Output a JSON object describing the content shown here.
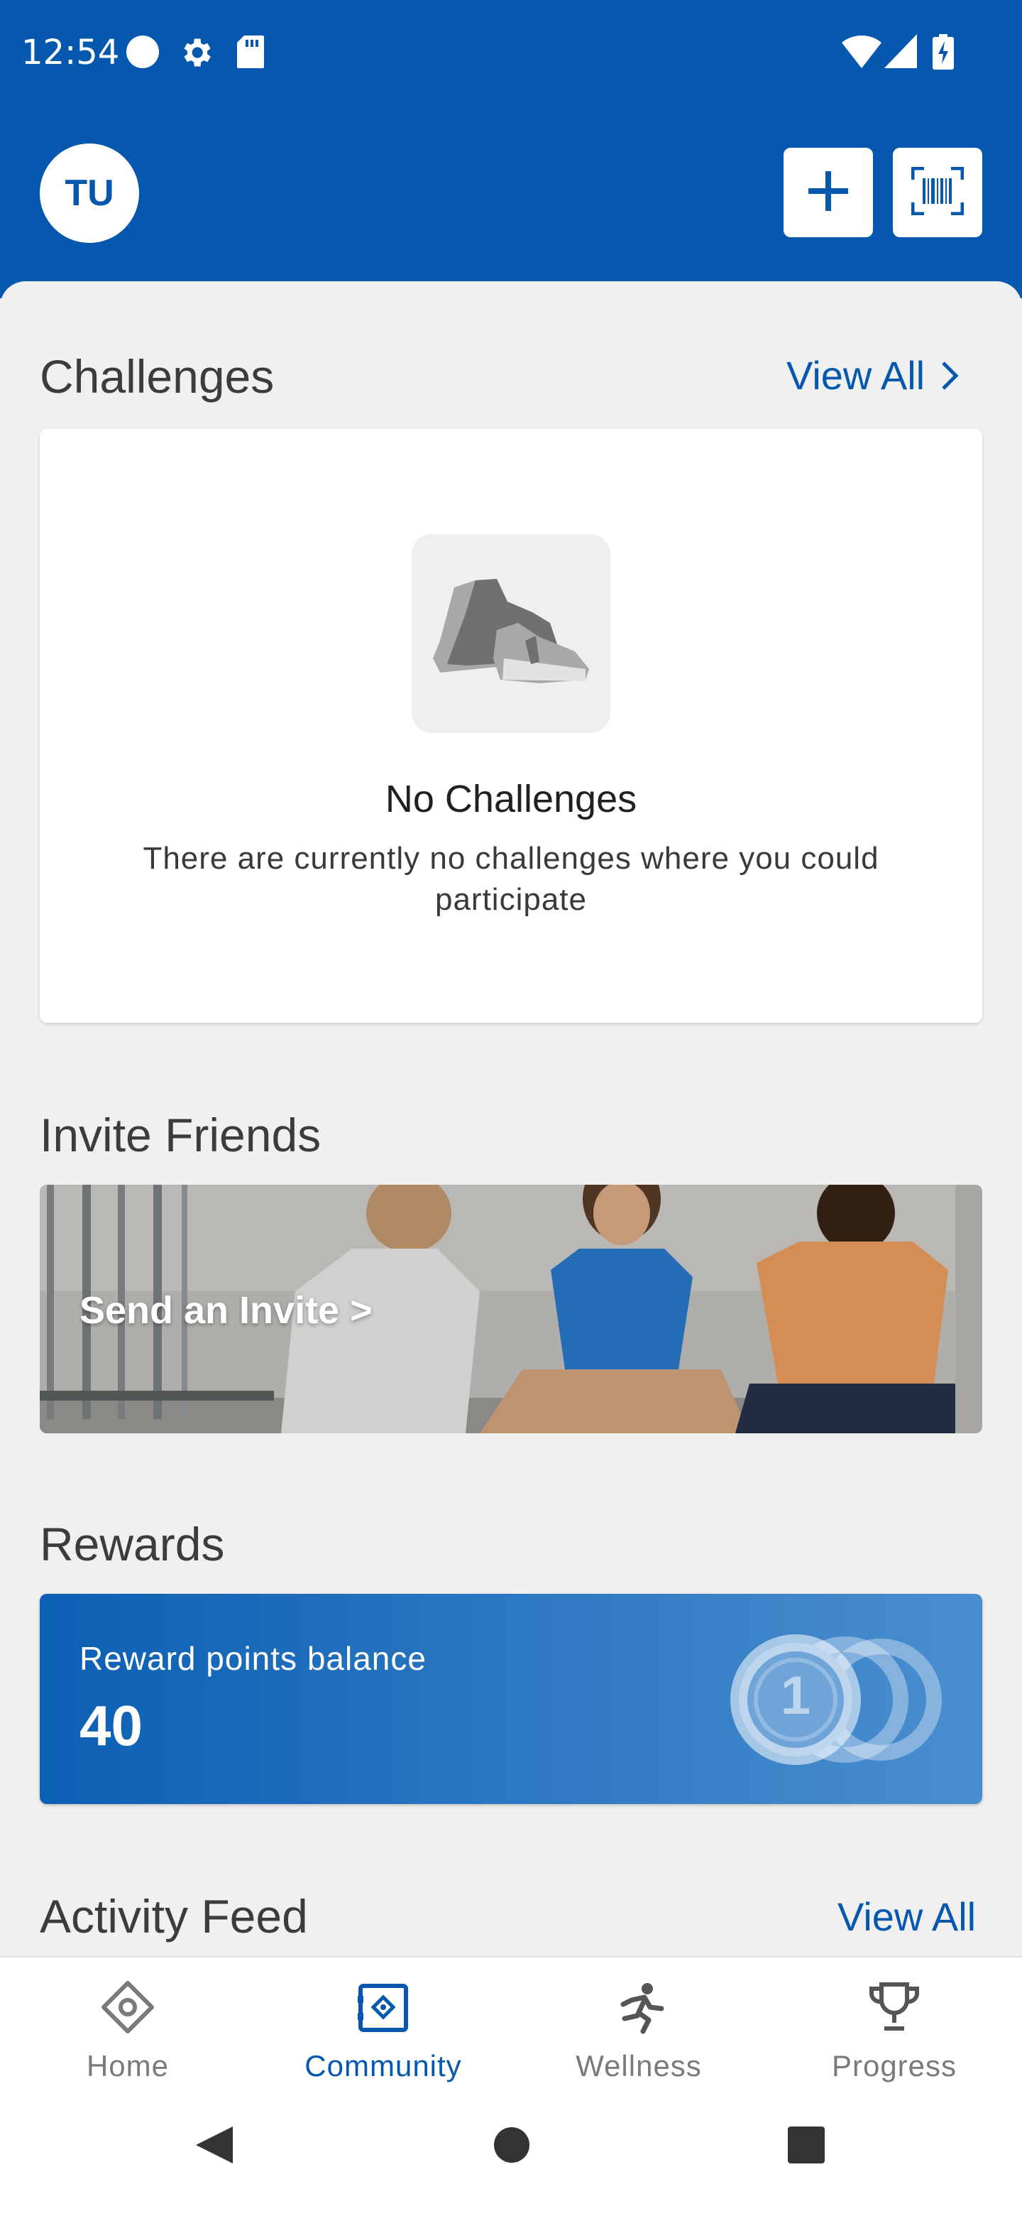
{
  "status_bar": {
    "time": "12:54",
    "icons": [
      "circle-icon",
      "settings-icon",
      "sd-card-icon",
      "wifi-icon",
      "signal-icon",
      "battery-charging-icon"
    ]
  },
  "header": {
    "avatar_initials": "TU",
    "add_icon": "plus-icon",
    "scan_icon": "barcode-scan-icon"
  },
  "challenges": {
    "title": "Challenges",
    "view_all": "View All",
    "empty_title": "No Challenges",
    "empty_message": "There are currently no challenges where you could participate",
    "empty_icon": "sneakers-icon"
  },
  "invite": {
    "title": "Invite Friends",
    "cta": "Send an Invite >"
  },
  "rewards": {
    "title": "Rewards",
    "label": "Reward points balance",
    "points": "40",
    "coin_label": "1"
  },
  "activity": {
    "title": "Activity Feed",
    "view_all": "View All"
  },
  "bottom_nav": {
    "items": [
      {
        "label": "Home",
        "icon": "home-diamond-icon"
      },
      {
        "label": "Community",
        "icon": "community-icon"
      },
      {
        "label": "Wellness",
        "icon": "running-icon"
      },
      {
        "label": "Progress",
        "icon": "trophy-icon"
      }
    ],
    "active": "Community"
  },
  "colors": {
    "brand_blue": "#0558ad",
    "background": "#f0f0f0",
    "nav_inactive": "#7a7a7a"
  }
}
